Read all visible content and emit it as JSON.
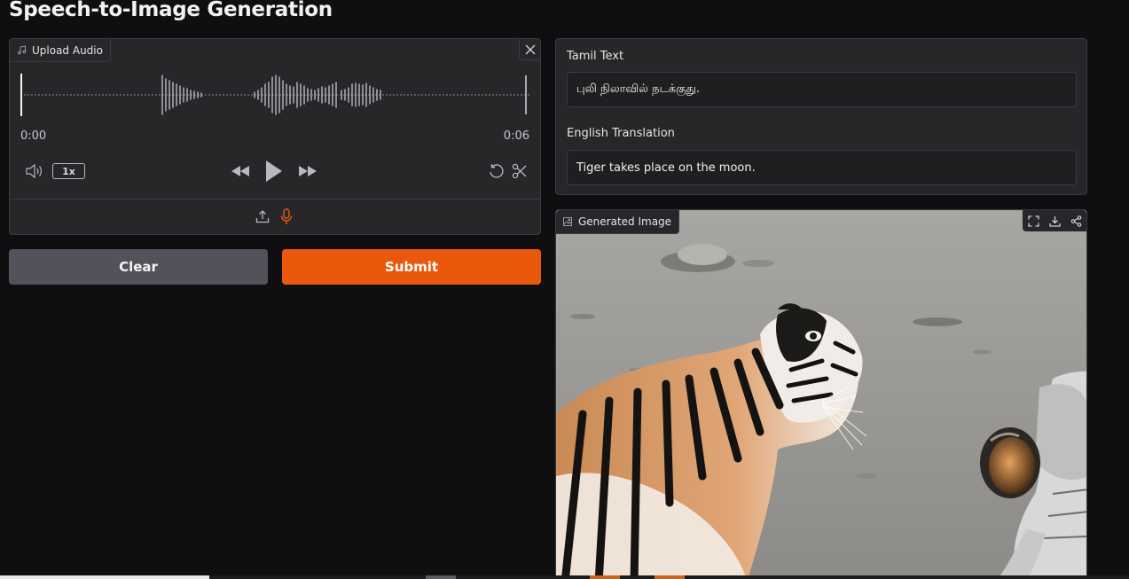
{
  "page": {
    "title": "Speech-to-Image Generation"
  },
  "audio": {
    "tag_label": "Upload Audio",
    "tag_icon": "music-icon",
    "time_start": "0:00",
    "time_end": "0:06",
    "speed": "1x",
    "playback_progress": 0
  },
  "buttons": {
    "clear": "Clear",
    "submit": "Submit"
  },
  "tamil": {
    "label": "Tamil Text",
    "value": "புலி நிலாவில் நடக்குது."
  },
  "english": {
    "label": "English Translation",
    "value": "Tiger takes place on the moon."
  },
  "image": {
    "tag_label": "Generated Image",
    "tag_icon": "image-icon"
  },
  "colors": {
    "accent": "#ea580c",
    "background": "#0f0f11",
    "panel": "#27272a",
    "clear_button": "#52525b"
  }
}
